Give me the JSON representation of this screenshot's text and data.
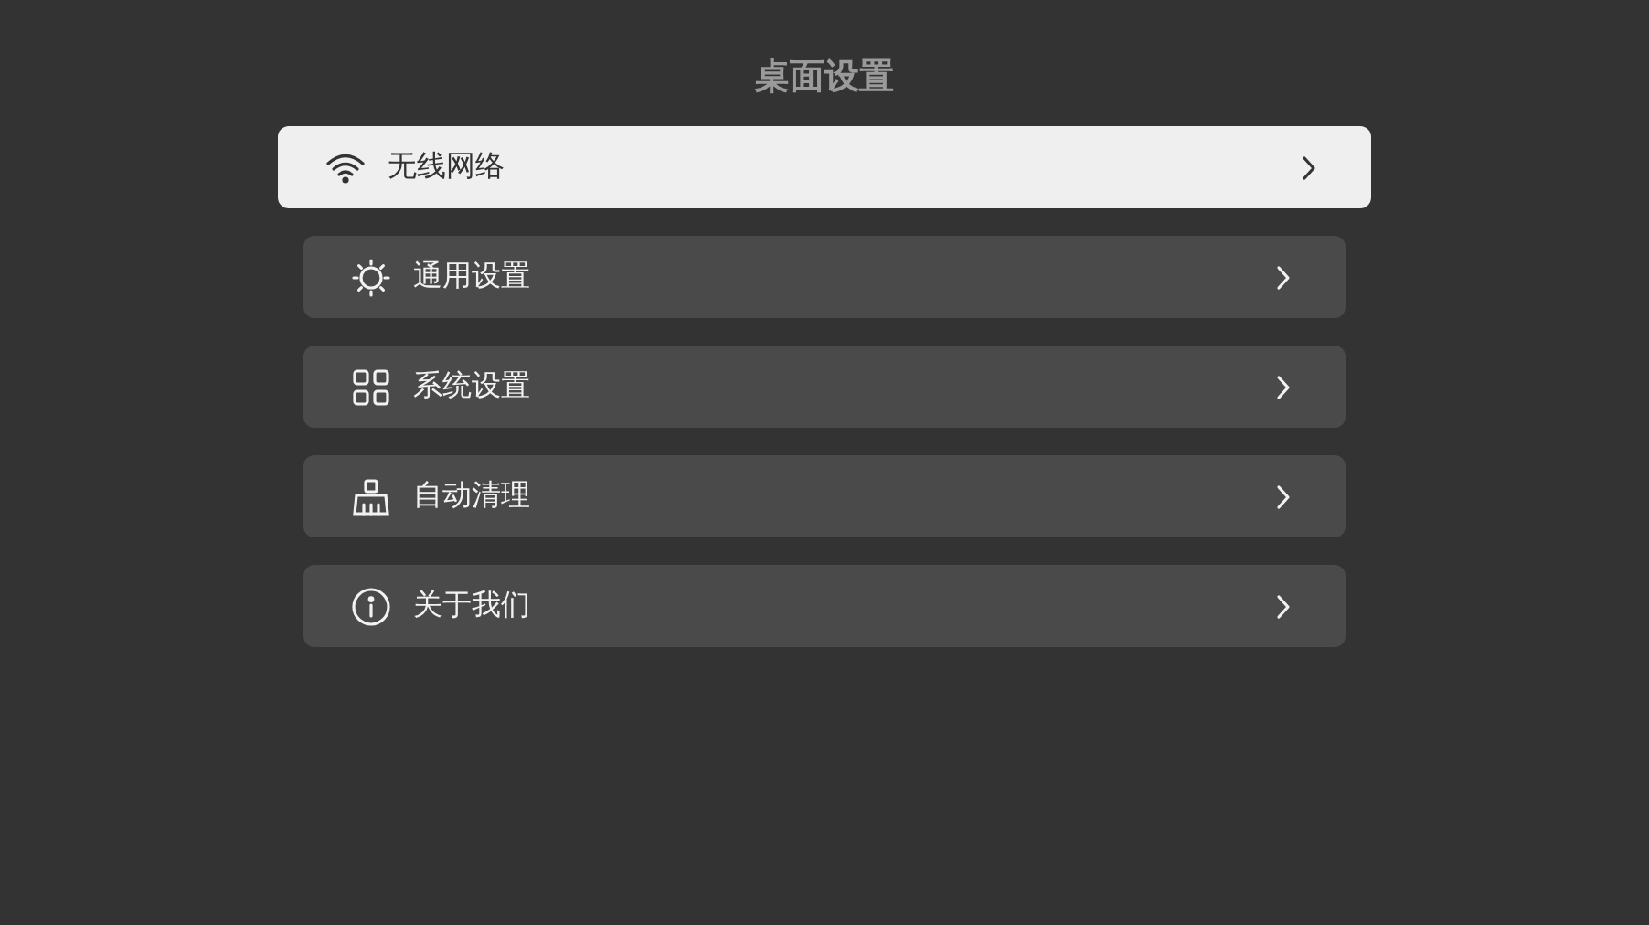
{
  "title": "桌面设置",
  "items": [
    {
      "label": "无线网络",
      "selected": true
    },
    {
      "label": "通用设置",
      "selected": false
    },
    {
      "label": "系统设置",
      "selected": false
    },
    {
      "label": "自动清理",
      "selected": false
    },
    {
      "label": "关于我们",
      "selected": false
    }
  ]
}
